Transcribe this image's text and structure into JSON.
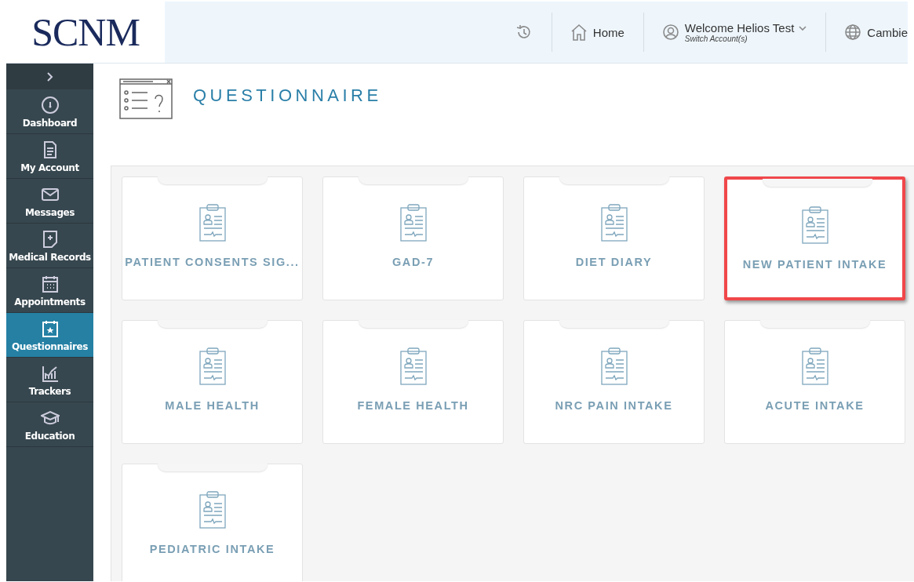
{
  "header": {
    "logo": "SCNM",
    "home": "Home",
    "welcome": "Welcome Helios Test",
    "switch_account": "Switch Account(s)",
    "location": "Cambie"
  },
  "sidebar": {
    "items": [
      {
        "label": "Dashboard",
        "selected": false
      },
      {
        "label": "My Account",
        "selected": false
      },
      {
        "label": "Messages",
        "selected": false
      },
      {
        "label": "Medical Records",
        "selected": false
      },
      {
        "label": "Appointments",
        "selected": false
      },
      {
        "label": "Questionnaires",
        "selected": true
      },
      {
        "label": "Trackers",
        "selected": false
      },
      {
        "label": "Education",
        "selected": false
      }
    ]
  },
  "page": {
    "title": "QUESTIONNAIRE"
  },
  "cards": [
    {
      "label": "PATIENT CONSENTS SIG...",
      "highlighted": false
    },
    {
      "label": "GAD-7",
      "highlighted": false
    },
    {
      "label": "DIET DIARY",
      "highlighted": false
    },
    {
      "label": "NEW PATIENT INTAKE",
      "highlighted": true
    },
    {
      "label": "MALE HEALTH",
      "highlighted": false
    },
    {
      "label": "FEMALE HEALTH",
      "highlighted": false
    },
    {
      "label": "NRC PAIN INTAKE",
      "highlighted": false
    },
    {
      "label": "ACUTE INTAKE",
      "highlighted": false
    },
    {
      "label": "PEDIATRIC INTAKE",
      "highlighted": false
    }
  ]
}
